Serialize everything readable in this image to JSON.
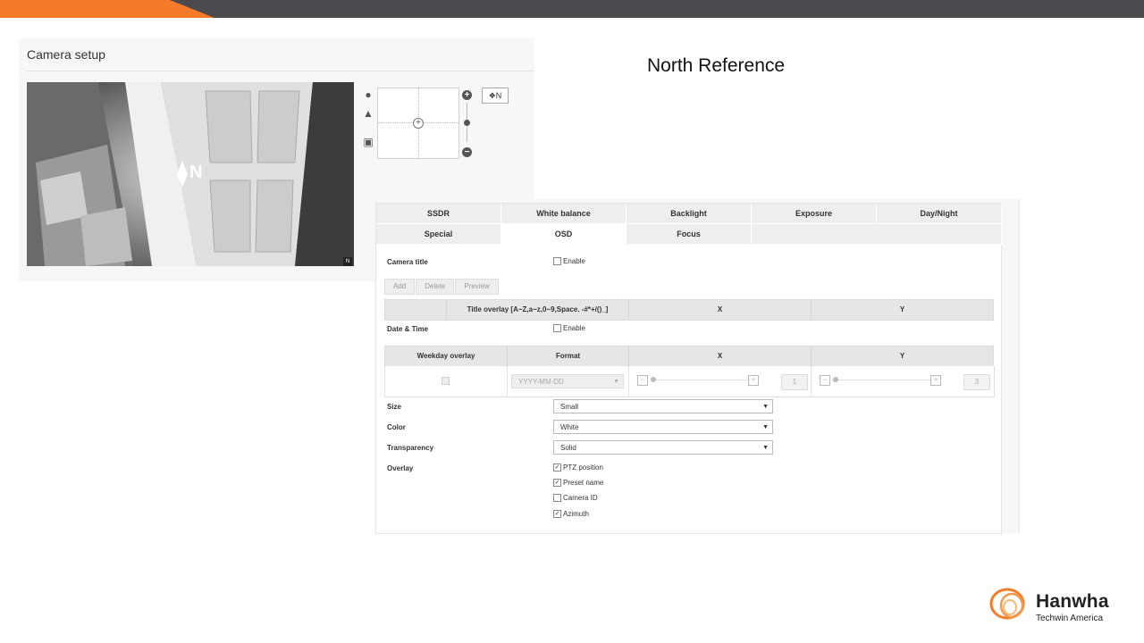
{
  "camera_setup": {
    "title": "Camera setup",
    "overlay_text": "N",
    "corner_badge": "N",
    "north_button_label": "N",
    "ptz_icons": [
      "person-icon",
      "landscape-icon",
      "focus-frame-icon"
    ],
    "zoom_in": "+",
    "zoom_out": "−"
  },
  "heading": "North Reference",
  "osd": {
    "tabs_row1": [
      "SSDR",
      "White balance",
      "Backlight",
      "Exposure",
      "Day/Night"
    ],
    "tabs_row2": [
      "Special",
      "OSD",
      "Focus"
    ],
    "active_tab": "OSD",
    "camera_title_label": "Camera title",
    "enable_label": "Enable",
    "buttons": [
      "Add",
      "Delete",
      "Preview"
    ],
    "title_table_headers": [
      "Title overlay [A~Z,a~z,0~9,Space. -#*+/()_]",
      "X",
      "Y"
    ],
    "date_time_label": "Date & Time",
    "date_table_headers": [
      "Weekday overlay",
      "Format",
      "X",
      "Y"
    ],
    "format_value": "YYYY-MM-DD",
    "x_value": "1",
    "y_value": "3",
    "size_label": "Size",
    "size_value": "Small",
    "color_label": "Color",
    "color_value": "White",
    "transparency_label": "Transparency",
    "transparency_value": "Solid",
    "overlay_label": "Overlay",
    "overlay_options": [
      {
        "label": "PTZ position",
        "checked": true
      },
      {
        "label": "Preset name",
        "checked": true
      },
      {
        "label": "Camera ID",
        "checked": false
      },
      {
        "label": "Azimuth",
        "checked": true
      }
    ]
  },
  "logo": {
    "name": "Hanwha",
    "sub": "Techwin America"
  },
  "colors": {
    "accent": "#f37b2a",
    "topbar": "#4a4a4f"
  }
}
